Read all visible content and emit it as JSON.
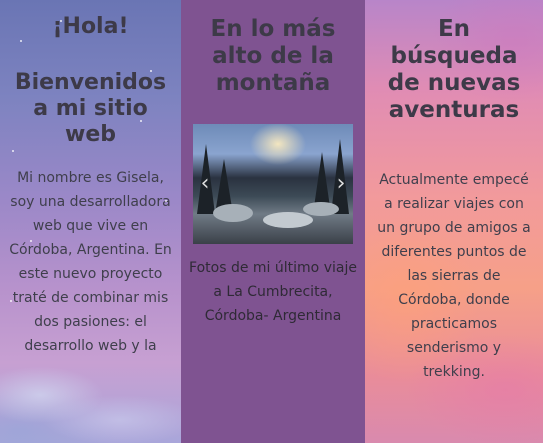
{
  "col1": {
    "greeting": "¡Hola!",
    "welcome": "Bienvenidos a mi sitio web",
    "text": "Mi nombre es Gisela, soy una desarrolladora web que vive en Córdoba, Argentina. En este nuevo proyecto traté de combinar mis dos pasiones: el desarrollo web y la"
  },
  "col2": {
    "title": "En lo más alto de la montaña",
    "caption": "Fotos de mi último viaje a La Cumbrecita, Córdoba- Argentina",
    "carousel": {
      "prev_icon": "‹",
      "next_icon": "›"
    }
  },
  "col3": {
    "title": "En búsqueda de nuevas aventuras",
    "text": "Actualmente empecé a realizar viajes con un grupo de amigos a diferentes puntos de las sierras de Córdoba, donde practicamos senderismo y trekking."
  }
}
